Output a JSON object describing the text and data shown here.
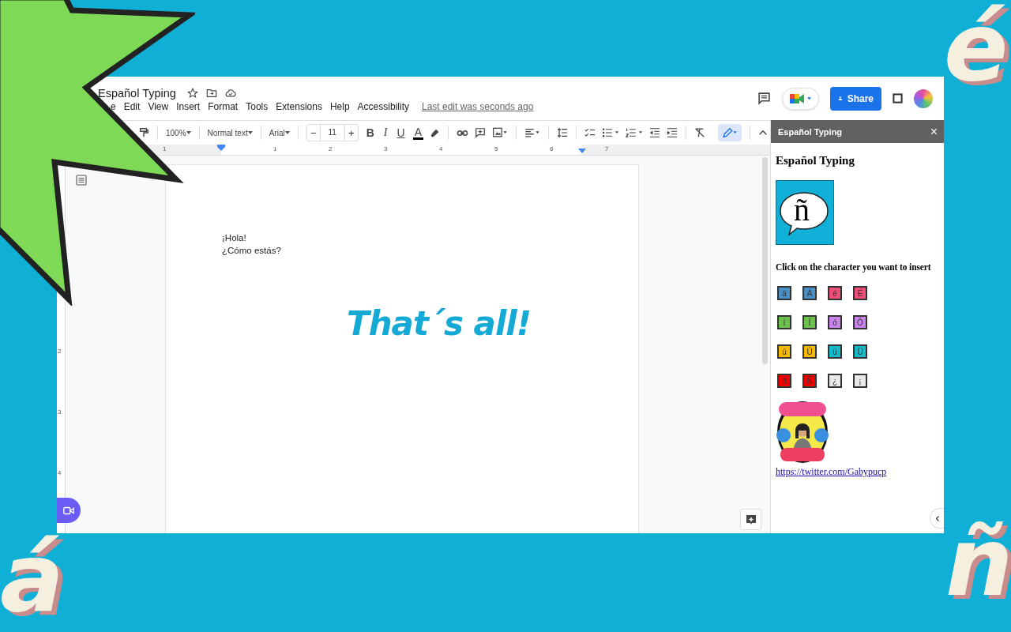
{
  "document": {
    "title": "Español Typing",
    "menu": [
      "e",
      "Edit",
      "View",
      "Insert",
      "Format",
      "Tools",
      "Extensions",
      "Help",
      "Accessibility"
    ],
    "last_edit": "Last edit was seconds ago",
    "share_label": "Share",
    "toolbar": {
      "zoom": "100%",
      "style": "Normal text",
      "font": "Arial",
      "decrease": "−",
      "font_size": "11",
      "increase": "+",
      "format_buttons": [
        {
          "label": "B",
          "kind": "bold"
        },
        {
          "label": "I",
          "kind": "italic"
        },
        {
          "label": "U",
          "kind": "underline"
        },
        {
          "label": "A",
          "kind": "color"
        }
      ]
    },
    "ruler": [
      "1",
      "1",
      "2",
      "3",
      "4",
      "5",
      "6",
      "7"
    ],
    "vertical_ruler": [
      "2",
      "3",
      "4"
    ],
    "body": [
      "¡Hola!",
      "¿Cómo estás?"
    ],
    "closing": "That´s all!"
  },
  "sidebar": {
    "title": "Español Typing",
    "close": "×",
    "heading": "Español Typing",
    "logo_glyph": "ñ",
    "instruction": "Click on the character you want to insert",
    "character_rows": [
      [
        {
          "label": "á",
          "color": "#4a8fc4"
        },
        {
          "label": "Á",
          "color": "#4a8fc4"
        },
        {
          "label": "é",
          "color": "#f04e78"
        },
        {
          "label": "É",
          "color": "#f04e78"
        }
      ],
      [
        {
          "label": "í",
          "color": "#6cc04a"
        },
        {
          "label": "Í",
          "color": "#6cc04a"
        },
        {
          "label": "ó",
          "color": "#c983ec"
        },
        {
          "label": "Ó",
          "color": "#c983ec"
        }
      ],
      [
        {
          "label": "ú",
          "color": "#f7b900"
        },
        {
          "label": "Ú",
          "color": "#f7b900"
        },
        {
          "label": "ü",
          "color": "#14bccb"
        },
        {
          "label": "Ü",
          "color": "#14bccb"
        }
      ],
      [
        {
          "label": "ñ",
          "color": "#f20000"
        },
        {
          "label": "Ñ",
          "color": "#f20000"
        },
        {
          "label": "¿",
          "color": "#e9e9e9"
        },
        {
          "label": "¡",
          "color": "#e9e9e9"
        }
      ]
    ],
    "link": "https://twitter.com/Gabypucp"
  },
  "decorations": [
    {
      "glyph": "é"
    },
    {
      "glyph": "á"
    },
    {
      "glyph": "ñ"
    }
  ]
}
